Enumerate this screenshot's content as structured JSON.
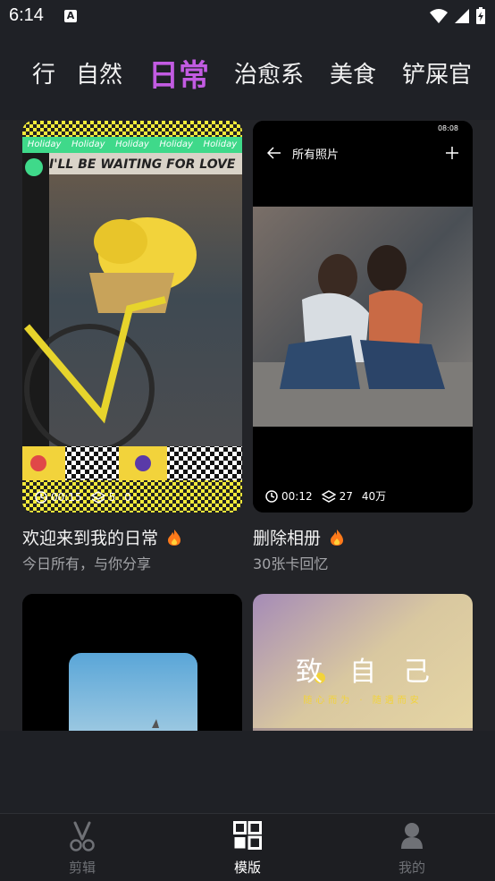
{
  "status": {
    "time": "6:14",
    "notif_letter": "A"
  },
  "tabs": [
    {
      "label": "行",
      "active": false
    },
    {
      "label": "自然",
      "active": false
    },
    {
      "label": "日常",
      "active": true
    },
    {
      "label": "治愈系",
      "active": false
    },
    {
      "label": "美食",
      "active": false
    },
    {
      "label": "铲屎官",
      "active": false
    }
  ],
  "cards": [
    {
      "title": "欢迎来到我的日常",
      "subtitle": "今日所有，与你分享",
      "duration": "00:15",
      "layers": "5",
      "uses": "0",
      "banner_text": [
        "Holiday",
        "Holiday",
        "Holiday",
        "Holiday",
        "Holiday"
      ],
      "handwriting": "I'LL BE WAITING FOR LOVE"
    },
    {
      "title": "删除相册",
      "subtitle": "30张卡回忆",
      "duration": "00:12",
      "layers": "27",
      "uses": "40万",
      "phone_time": "08:08",
      "phone_title": "所有照片"
    },
    {
      "title": "",
      "subtitle": ""
    },
    {
      "title": "",
      "subtitle": "",
      "poster_chars": [
        "致",
        "自",
        "己"
      ],
      "poster_sub": "随心而为 · 随遇而安"
    }
  ],
  "bottom_nav": [
    {
      "label": "剪辑",
      "icon": "scissors-icon",
      "active": false
    },
    {
      "label": "模版",
      "icon": "template-grid-icon",
      "active": true
    },
    {
      "label": "我的",
      "icon": "profile-icon",
      "active": false
    }
  ],
  "colors": {
    "accent": "#c25be2",
    "background": "#1f2126"
  }
}
